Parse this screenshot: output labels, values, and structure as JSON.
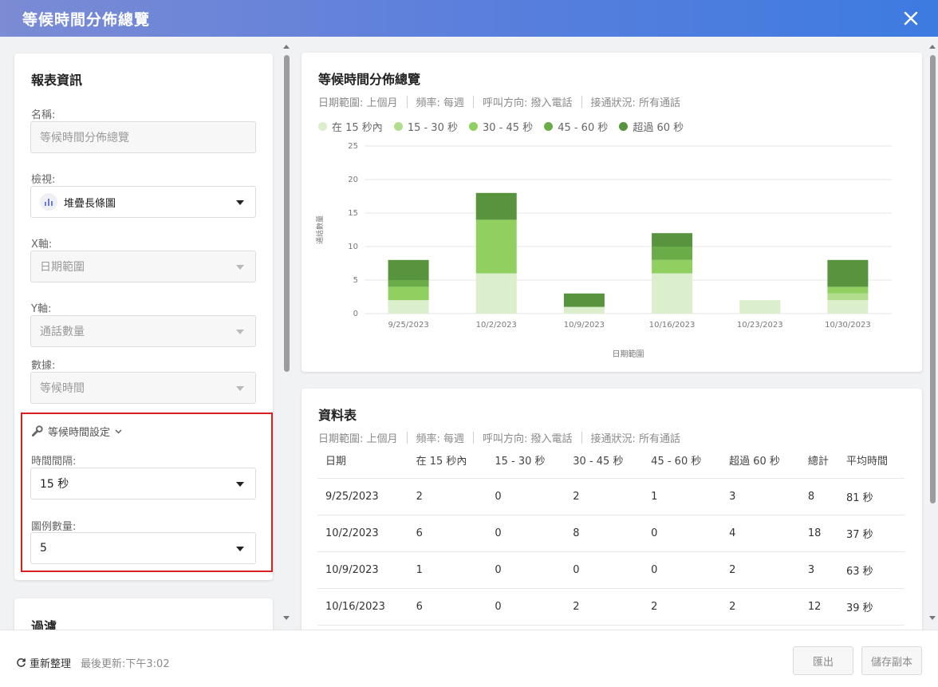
{
  "window": {
    "title": "等候時間分佈總覽"
  },
  "report_info": {
    "title": "報表資訊",
    "name_label": "名稱:",
    "name_value": "等候時間分佈總覽",
    "view_label": "檢視:",
    "view_value": "堆疊長條圖",
    "xaxis_label": "X軸:",
    "xaxis_value": "日期範圍",
    "yaxis_label": "Y軸:",
    "yaxis_value": "通話數量",
    "data_label": "數據:",
    "data_value": "等候時間",
    "settings_label": "等候時間設定",
    "interval_label": "時間間隔:",
    "interval_value": "15 秒",
    "legend_count_label": "圖例數量:",
    "legend_count_value": "5"
  },
  "filter": {
    "title": "過濾"
  },
  "meta": {
    "date_range": "日期範圍: 上個月",
    "frequency": "頻率: 每週",
    "direction": "呼叫方向: 撥入電話",
    "status": "接通狀況: 所有通話"
  },
  "chart_card": {
    "title": "等候時間分佈總覽"
  },
  "chart_data": {
    "type": "bar",
    "stacked": true,
    "xlabel": "日期範圍",
    "ylabel": "通話數量",
    "ylim": [
      0,
      25
    ],
    "yticks": [
      0,
      5,
      10,
      15,
      20,
      25
    ],
    "categories": [
      "9/25/2023",
      "10/2/2023",
      "10/9/2023",
      "10/16/2023",
      "10/23/2023",
      "10/30/2023"
    ],
    "series": [
      {
        "name": "在 15 秒內",
        "color": "#dcefcc",
        "values": [
          2,
          6,
          1,
          6,
          2,
          2
        ]
      },
      {
        "name": "15 - 30 秒",
        "color": "#b2dd8c",
        "values": [
          0,
          0,
          0,
          0,
          0,
          1
        ]
      },
      {
        "name": "30 - 45 秒",
        "color": "#8fd060",
        "values": [
          2,
          8,
          0,
          2,
          0,
          1
        ]
      },
      {
        "name": "45 - 60 秒",
        "color": "#6aac47",
        "values": [
          1,
          0,
          0,
          2,
          0,
          0
        ]
      },
      {
        "name": "超過 60 秒",
        "color": "#57943d",
        "values": [
          3,
          4,
          2,
          2,
          0,
          4
        ]
      }
    ],
    "grid": true,
    "legend": "top-left"
  },
  "table": {
    "title": "資料表",
    "headers": [
      "日期",
      "在 15 秒內",
      "15 - 30 秒",
      "30 - 45 秒",
      "45 - 60 秒",
      "超過 60 秒",
      "總計",
      "平均時間"
    ],
    "rows": [
      [
        "9/25/2023",
        "2",
        "0",
        "2",
        "1",
        "3",
        "8",
        "81 秒"
      ],
      [
        "10/2/2023",
        "6",
        "0",
        "8",
        "0",
        "4",
        "18",
        "37 秒"
      ],
      [
        "10/9/2023",
        "1",
        "0",
        "0",
        "0",
        "2",
        "3",
        "63 秒"
      ],
      [
        "10/16/2023",
        "6",
        "0",
        "2",
        "2",
        "2",
        "12",
        "39 秒"
      ]
    ]
  },
  "footer": {
    "refresh_label": "重新整理",
    "last_updated": "最後更新:下午3:02",
    "export_label": "匯出",
    "save_copy_label": "儲存副本"
  }
}
